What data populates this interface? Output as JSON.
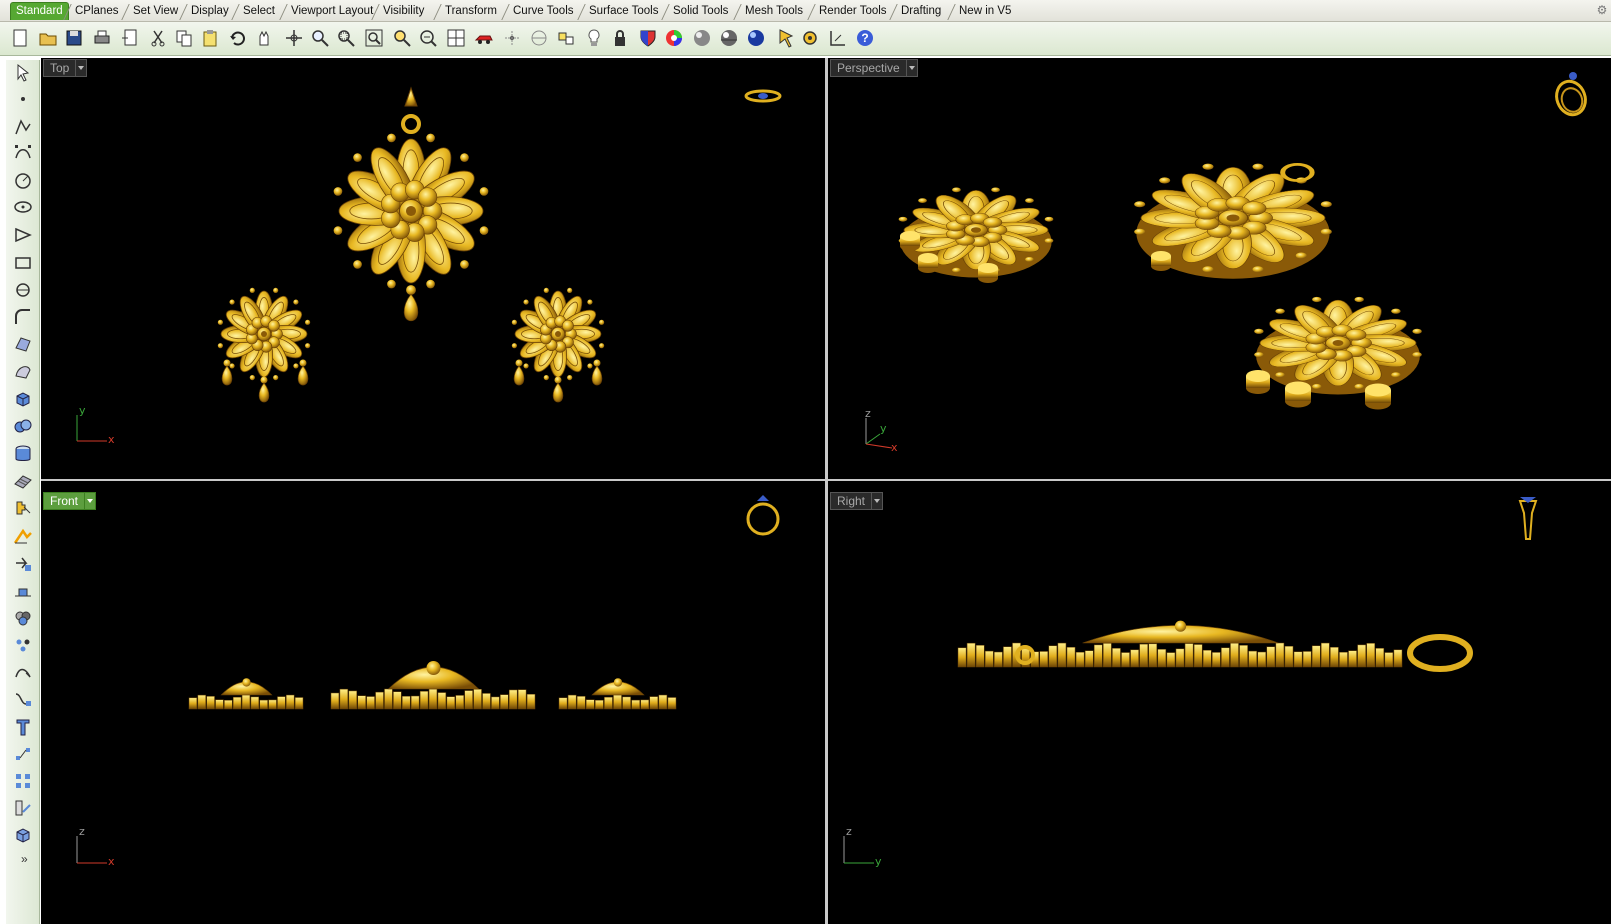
{
  "tabs": [
    {
      "label": "Standard",
      "active": true
    },
    {
      "label": "CPlanes"
    },
    {
      "label": "Set View"
    },
    {
      "label": "Display"
    },
    {
      "label": "Select"
    },
    {
      "label": "Viewport Layout"
    },
    {
      "label": "Visibility"
    },
    {
      "label": "Transform"
    },
    {
      "label": "Curve Tools"
    },
    {
      "label": "Surface Tools"
    },
    {
      "label": "Solid Tools"
    },
    {
      "label": "Mesh Tools"
    },
    {
      "label": "Render Tools"
    },
    {
      "label": "Drafting"
    },
    {
      "label": "New in V5"
    }
  ],
  "toolbar_icons": [
    "new-file-icon",
    "open-folder-icon",
    "save-icon",
    "print-icon",
    "import-icon",
    "cut-icon",
    "copy-icon",
    "paste-icon",
    "undo-icon",
    "pan-hand-icon",
    "rotate-view-icon",
    "zoom-icon",
    "zoom-window-icon",
    "zoom-extents-icon",
    "zoom-selected-icon",
    "rotate-camera-icon",
    "four-viewports-icon",
    "car-render-icon",
    "grid-snap-icon",
    "cplane-icon",
    "layer-icon",
    "light-bulb-icon",
    "lock-icon",
    "color-shield-icon",
    "color-wheel-icon",
    "shaded-sphere-icon",
    "rendered-sphere-icon",
    "blue-sphere-icon",
    "pin-icon",
    "gear-options-icon",
    "dimension-icon",
    "help-icon"
  ],
  "left_icons": [
    "select-arrow-icon",
    "point-icon",
    "polyline-icon",
    "curve-points-icon",
    "circle-icon",
    "ellipse-icon",
    "polygon-icon",
    "rectangle-icon",
    "arc-icon",
    "fillet-icon",
    "surface-grid-icon",
    "surface-icon",
    "box-solid-icon",
    "boolean-spheres-icon",
    "cylinder-icon",
    "mesh-plane-icon",
    "explode-puzzle-icon",
    "move-icon",
    "trim-icon",
    "plane-icon",
    "boolean-union-icon",
    "point-cloud-icon",
    "curve-edit-icon",
    "sweep-icon",
    "text-icon",
    "control-points-icon",
    "array-icon",
    "rebuild-icon",
    "cube-icon"
  ],
  "left_more": "»",
  "viewports": {
    "top": {
      "label": "Top",
      "axis1": "y",
      "axis2": "x",
      "active": false
    },
    "perspective": {
      "label": "Perspective",
      "axis1": "z",
      "axis2": "y",
      "axis3": "x",
      "active": false
    },
    "front": {
      "label": "Front",
      "axis1": "z",
      "axis2": "x",
      "active": true
    },
    "right": {
      "label": "Right",
      "axis1": "z",
      "axis2": "y",
      "active": false
    }
  },
  "colors": {
    "gold": "#e0b020",
    "gold_light": "#ffe36a",
    "gold_dark": "#8a5a08",
    "axis_x": "#d23a2a",
    "axis_y": "#3aa63a",
    "axis_z": "#9a9a9a",
    "active_tab": "#56a832"
  }
}
